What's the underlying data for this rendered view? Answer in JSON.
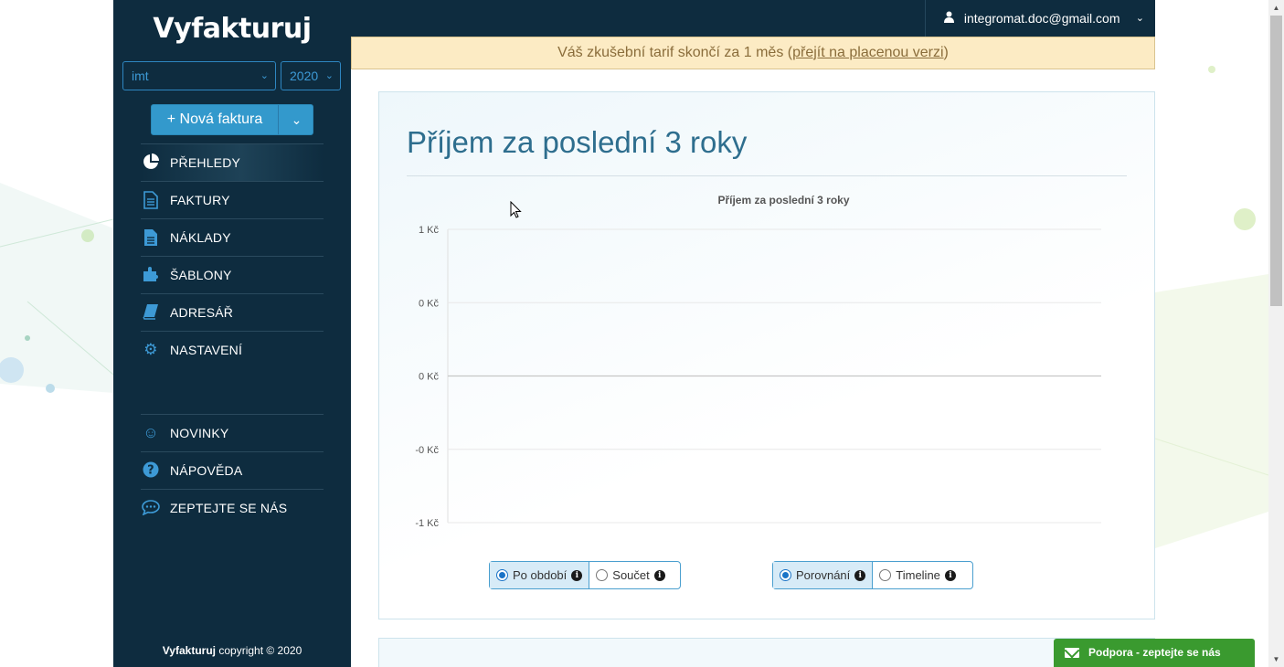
{
  "sidebar": {
    "logo": "Vyfakturuj",
    "company_select": "imt",
    "year_select": "2020",
    "new_invoice": "+ Nová faktura",
    "nav_top": [
      {
        "label": "PŘEHLEDY",
        "icon": "pie-chart-icon",
        "active": true
      },
      {
        "label": "FAKTURY",
        "icon": "document-icon"
      },
      {
        "label": "NÁKLADY",
        "icon": "file-icon"
      },
      {
        "label": "ŠABLONY",
        "icon": "puzzle-icon"
      },
      {
        "label": "ADRESÁŘ",
        "icon": "book-icon"
      },
      {
        "label": "NASTAVENÍ",
        "icon": "gear-icon"
      }
    ],
    "nav_bottom": [
      {
        "label": "NOVINKY",
        "icon": "smile-icon"
      },
      {
        "label": "NÁPOVĚDA",
        "icon": "question-icon"
      },
      {
        "label": "ZEPTEJTE SE NÁS",
        "icon": "chat-icon"
      }
    ],
    "footer_brand": "Vyfakturuj",
    "footer_text": "copyright © 2020"
  },
  "topbar": {
    "user_email": "integromat.doc@gmail.com"
  },
  "banner": {
    "text_before": "Váš zkušební tarif skončí za 1 měs (",
    "link": "přejít na placenou verzi",
    "text_after": ")"
  },
  "card": {
    "title": "Příjem za poslední 3 roky"
  },
  "chart_data": {
    "type": "line",
    "title": "Příjem za poslední 3 roky",
    "xlabel": "",
    "ylabel": "",
    "ylim": [
      -1,
      1
    ],
    "y_ticks": [
      1,
      0.5,
      0,
      -0.5,
      -1
    ],
    "y_tick_labels": [
      "1 Kč",
      "0 Kč",
      "0 Kč",
      "-0 Kč",
      "-1 Kč"
    ],
    "series": [],
    "grid": true
  },
  "controls": {
    "group1": [
      "Po období",
      "Součet"
    ],
    "group1_selected": 0,
    "group2": [
      "Porovnání",
      "Timeline"
    ],
    "group2_selected": 0
  },
  "support": {
    "label": "Podpora - zeptejte se nás"
  },
  "colors": {
    "sidebar_bg": "#0e2c3f",
    "accent": "#3399cc",
    "banner_bg": "#fcebc4",
    "support_green": "#3a9a2f",
    "title_blue": "#2e6e8e"
  }
}
